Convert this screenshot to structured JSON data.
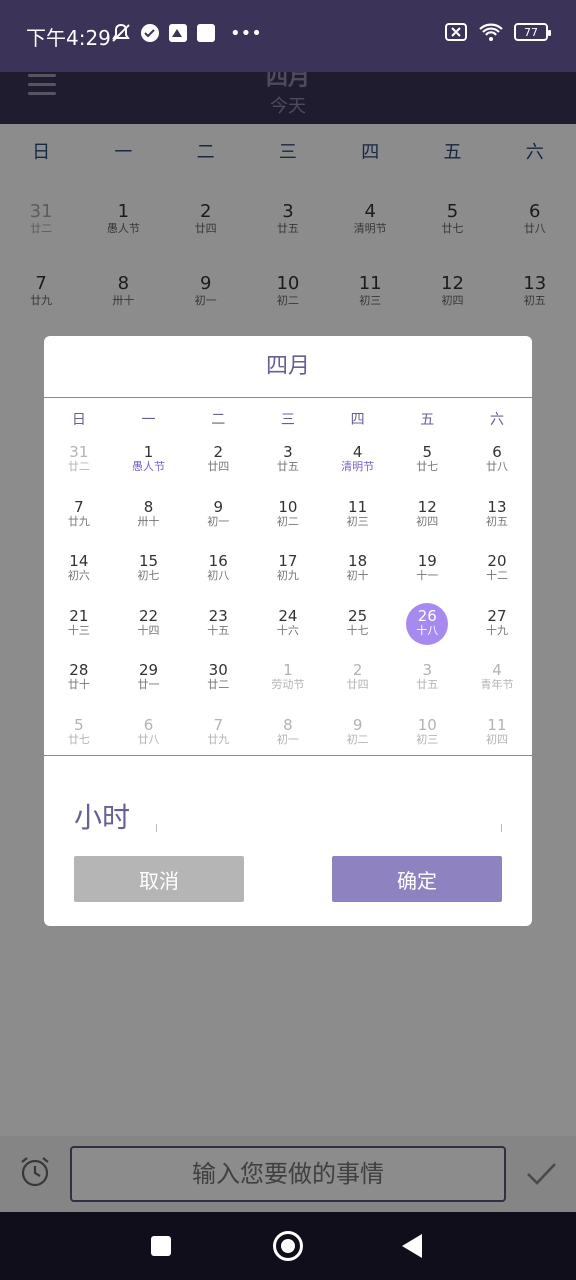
{
  "status_bar": {
    "time": "下午4:29",
    "battery": "77"
  },
  "app_bar": {
    "title": "四月",
    "subtitle": "今天"
  },
  "background_calendar": {
    "weekdays": [
      "日",
      "一",
      "二",
      "三",
      "四",
      "五",
      "六"
    ],
    "rows": [
      [
        {
          "n": "31",
          "l": "廿二",
          "dim": true
        },
        {
          "n": "1",
          "l": "愚人节"
        },
        {
          "n": "2",
          "l": "廿四"
        },
        {
          "n": "3",
          "l": "廿五"
        },
        {
          "n": "4",
          "l": "清明节"
        },
        {
          "n": "5",
          "l": "廿七"
        },
        {
          "n": "6",
          "l": "廿八"
        }
      ],
      [
        {
          "n": "7",
          "l": "廿九"
        },
        {
          "n": "8",
          "l": "卅十"
        },
        {
          "n": "9",
          "l": "初一"
        },
        {
          "n": "10",
          "l": "初二"
        },
        {
          "n": "11",
          "l": "初三"
        },
        {
          "n": "12",
          "l": "初四"
        },
        {
          "n": "13",
          "l": "初五"
        }
      ]
    ]
  },
  "dialog": {
    "title": "四月",
    "weekdays": [
      "日",
      "一",
      "二",
      "三",
      "四",
      "五",
      "六"
    ],
    "rows": [
      [
        {
          "n": "31",
          "l": "廿二",
          "dim": true
        },
        {
          "n": "1",
          "l": "愚人节",
          "hl": true
        },
        {
          "n": "2",
          "l": "廿四"
        },
        {
          "n": "3",
          "l": "廿五"
        },
        {
          "n": "4",
          "l": "清明节",
          "hl": true
        },
        {
          "n": "5",
          "l": "廿七"
        },
        {
          "n": "6",
          "l": "廿八"
        }
      ],
      [
        {
          "n": "7",
          "l": "廿九"
        },
        {
          "n": "8",
          "l": "卅十"
        },
        {
          "n": "9",
          "l": "初一"
        },
        {
          "n": "10",
          "l": "初二"
        },
        {
          "n": "11",
          "l": "初三"
        },
        {
          "n": "12",
          "l": "初四"
        },
        {
          "n": "13",
          "l": "初五"
        }
      ],
      [
        {
          "n": "14",
          "l": "初六"
        },
        {
          "n": "15",
          "l": "初七"
        },
        {
          "n": "16",
          "l": "初八"
        },
        {
          "n": "17",
          "l": "初九"
        },
        {
          "n": "18",
          "l": "初十"
        },
        {
          "n": "19",
          "l": "十一"
        },
        {
          "n": "20",
          "l": "十二"
        }
      ],
      [
        {
          "n": "21",
          "l": "十三"
        },
        {
          "n": "22",
          "l": "十四"
        },
        {
          "n": "23",
          "l": "十五"
        },
        {
          "n": "24",
          "l": "十六"
        },
        {
          "n": "25",
          "l": "十七"
        },
        {
          "n": "26",
          "l": "十八",
          "sel": true
        },
        {
          "n": "27",
          "l": "十九"
        }
      ],
      [
        {
          "n": "28",
          "l": "廿十"
        },
        {
          "n": "29",
          "l": "廿一"
        },
        {
          "n": "30",
          "l": "廿二"
        },
        {
          "n": "1",
          "l": "劳动节",
          "dim": true
        },
        {
          "n": "2",
          "l": "廿四",
          "dim": true
        },
        {
          "n": "3",
          "l": "廿五",
          "dim": true
        },
        {
          "n": "4",
          "l": "青年节",
          "dim": true
        }
      ],
      [
        {
          "n": "5",
          "l": "廿七",
          "dim": true
        },
        {
          "n": "6",
          "l": "廿八",
          "dim": true
        },
        {
          "n": "7",
          "l": "廿九",
          "dim": true
        },
        {
          "n": "8",
          "l": "初一",
          "dim": true
        },
        {
          "n": "9",
          "l": "初二",
          "dim": true
        },
        {
          "n": "10",
          "l": "初三",
          "dim": true
        },
        {
          "n": "11",
          "l": "初四",
          "dim": true
        }
      ]
    ],
    "hour_label": "小时",
    "cancel_label": "取消",
    "ok_label": "确定"
  },
  "bottom_bar": {
    "placeholder": "输入您要做的事情"
  }
}
